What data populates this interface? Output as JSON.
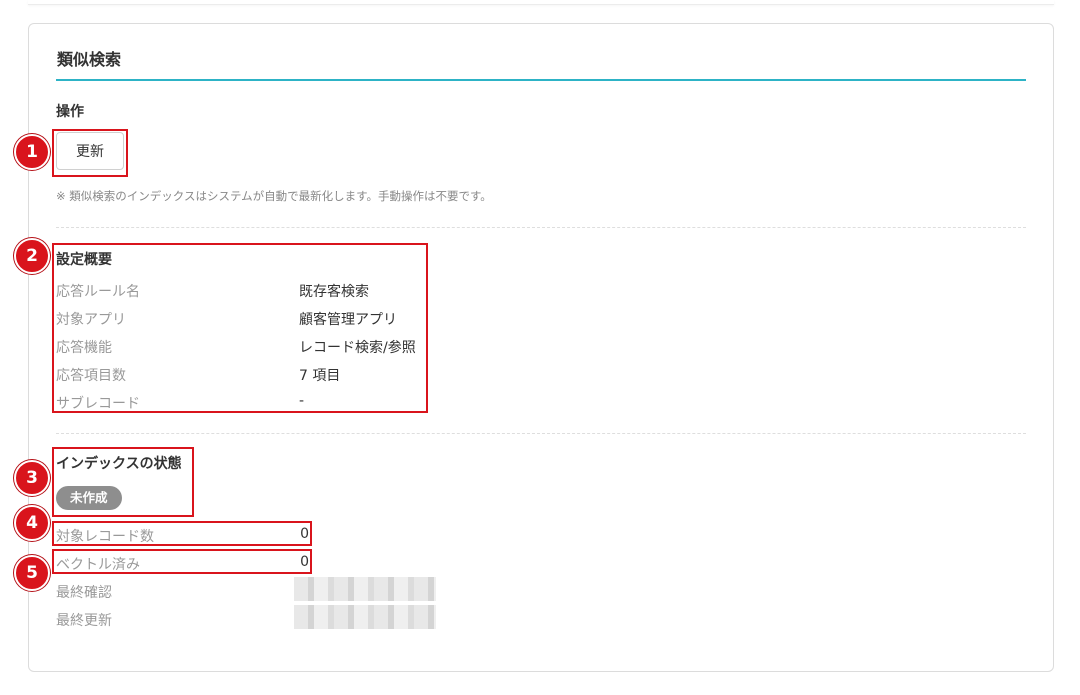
{
  "section_title": "類似検索",
  "operations": {
    "heading": "操作",
    "refresh_button": "更新",
    "note": "※ 類似検索のインデックスはシステムが自動で最新化します。手動操作は不要です。"
  },
  "settings": {
    "heading": "設定概要",
    "rows": [
      {
        "label": "応答ルール名",
        "value": "既存客検索"
      },
      {
        "label": "対象アプリ",
        "value": "顧客管理アプリ"
      },
      {
        "label": "応答機能",
        "value": "レコード検索/参照"
      },
      {
        "label": "応答項目数",
        "value": "7 項目"
      },
      {
        "label": "サブレコード",
        "value": "-"
      }
    ]
  },
  "index_status": {
    "heading": "インデックスの状態",
    "badge": "未作成",
    "target_records": {
      "label": "対象レコード数",
      "value": "0"
    },
    "vectorized": {
      "label": "ベクトル済み",
      "value": "0"
    },
    "last_checked": {
      "label": "最終確認"
    },
    "last_updated": {
      "label": "最終更新"
    }
  },
  "markers": [
    "1",
    "2",
    "3",
    "4",
    "5"
  ],
  "colors": {
    "accent_rule": "#2db3c6",
    "highlight_red": "#d9141c",
    "badge_gray": "#8e8e8e"
  }
}
